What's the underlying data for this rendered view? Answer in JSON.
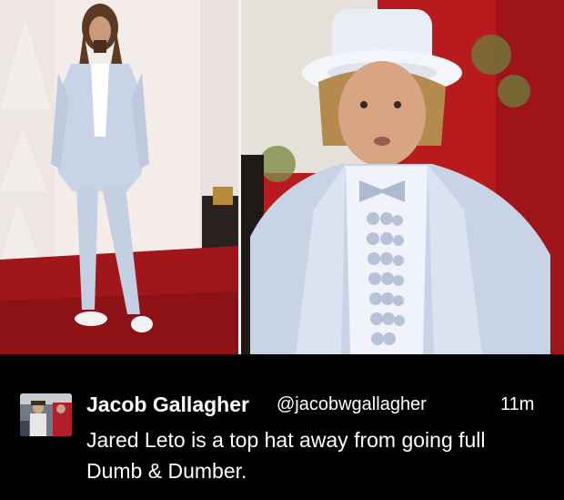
{
  "tweet": {
    "display_name": "Jacob Gallagher",
    "handle": "@jacobwgallagher",
    "timestamp": "11m",
    "text": "Jared Leto is a top hat away from going full Dumb & Dumber."
  },
  "images": [
    {
      "name": "red-carpet-photo"
    },
    {
      "name": "movie-still-photo"
    }
  ],
  "colors": {
    "background": "#000000",
    "suit_blue": "#c9d3e6",
    "carpet_red": "#a0161b",
    "text": "#ffffff"
  }
}
